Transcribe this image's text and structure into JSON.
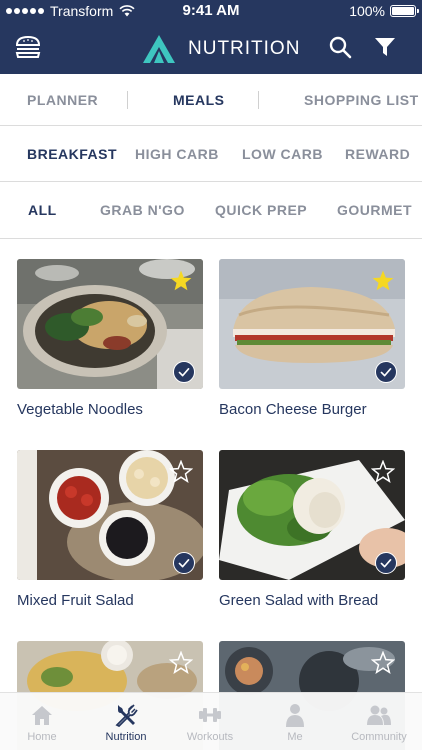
{
  "status_bar": {
    "carrier": "Transform",
    "time": "9:41 AM",
    "battery": "100%"
  },
  "header": {
    "title": "NUTRITION"
  },
  "main_tabs": [
    {
      "label": "PLANNER",
      "active": false
    },
    {
      "label": "MEALS",
      "active": true
    },
    {
      "label": "SHOPPING LIST",
      "active": false
    }
  ],
  "meal_tabs": [
    {
      "label": "BREAKFAST",
      "active": true
    },
    {
      "label": "HIGH CARB",
      "active": false
    },
    {
      "label": "LOW CARB",
      "active": false
    },
    {
      "label": "REWARD",
      "active": false
    }
  ],
  "filter_tabs": [
    {
      "label": "ALL",
      "active": true
    },
    {
      "label": "GRAB N'GO",
      "active": false
    },
    {
      "label": "QUICK PREP",
      "active": false
    },
    {
      "label": "GOURMET",
      "active": false
    }
  ],
  "meals": [
    {
      "title": "Vegetable Noodles",
      "favorite": true,
      "checked": true
    },
    {
      "title": "Bacon Cheese Burger",
      "favorite": true,
      "checked": true
    },
    {
      "title": "Mixed Fruit Salad",
      "favorite": false,
      "checked": true
    },
    {
      "title": "Green Salad with Bread",
      "favorite": false,
      "checked": true
    },
    {
      "title": "",
      "favorite": false,
      "checked": false
    },
    {
      "title": "",
      "favorite": false,
      "checked": false
    }
  ],
  "bottom_tabs": [
    {
      "label": "Home",
      "icon": "home-icon",
      "active": false
    },
    {
      "label": "Nutrition",
      "icon": "fork-knife-icon",
      "active": true
    },
    {
      "label": "Workouts",
      "icon": "dumbbell-icon",
      "active": false
    },
    {
      "label": "Me",
      "icon": "person-icon",
      "active": false
    },
    {
      "label": "Community",
      "icon": "people-icon",
      "active": false
    }
  ],
  "colors": {
    "brand_navy": "#26375f",
    "accent_teal": "#3ec6c0",
    "star_yellow": "#f5d823",
    "inactive_gray": "#8a8f9b"
  }
}
